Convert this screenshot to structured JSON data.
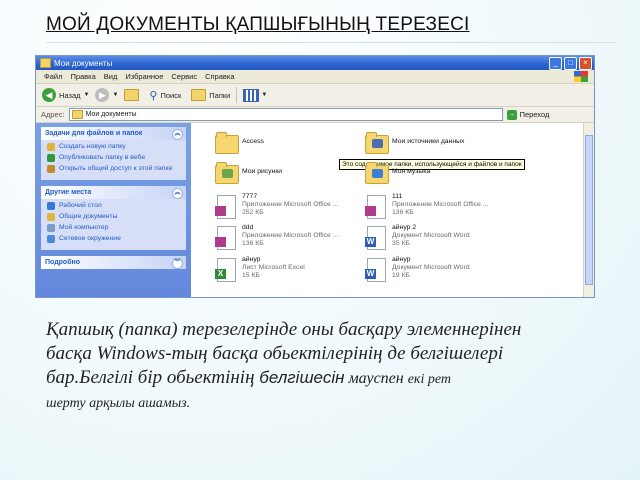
{
  "slide": {
    "title": "МОЙ ДОКУМЕНТЫ ҚАПШЫҒЫНЫҢ ТЕРЕЗЕСІ",
    "caption": {
      "line1": "Қапшық (папка) терезелерінде оны басқару элеменнерінен",
      "line2": "басқа Windows-тың басқа обьектілерінің де белгішелері",
      "line3_a": "бар.Белгілі бір  обьектінің ",
      "line3_b": "белгішесін",
      "line3_c": " мауспен ",
      "line3_d": "екі рет",
      "line4": "шерту арқылы ашамыз."
    }
  },
  "window": {
    "title": "Мои документы",
    "menu": [
      "Файл",
      "Правка",
      "Вид",
      "Избранное",
      "Сервис",
      "Справка"
    ],
    "toolbar": {
      "back": "Назад",
      "search": "Поиск",
      "folders": "Папки"
    },
    "address": {
      "label": "Адрес:",
      "value": "Мои документы",
      "go": "Переход"
    },
    "tasks": {
      "panel1_title": "Задачи для файлов и папок",
      "panel1_items": [
        {
          "label": "Создать новую папку",
          "icon": "new-folder-icon",
          "color": "#e0b53a"
        },
        {
          "label": "Опубликовать папку в вебе",
          "icon": "globe-icon",
          "color": "#2f9a3a"
        },
        {
          "label": "Открыть общий доступ к этой папке",
          "icon": "share-icon",
          "color": "#c68a2a"
        }
      ],
      "panel2_title": "Другие места",
      "panel2_items": [
        {
          "label": "Рабочий стол",
          "icon": "desktop-icon",
          "color": "#3a78d8"
        },
        {
          "label": "Общие документы",
          "icon": "folder-icon",
          "color": "#e0b53a"
        },
        {
          "label": "Мой компьютер",
          "icon": "computer-icon",
          "color": "#7a9cc8"
        },
        {
          "label": "Сетевое окружение",
          "icon": "network-icon",
          "color": "#4a8ad8"
        }
      ],
      "panel3_title": "Подробно"
    },
    "tooltip": "Это содержимое папки, использующейся и файлов и папок",
    "files": [
      {
        "name": "Ассеss",
        "sub1": "",
        "sub2": "",
        "icon": "folder-icon",
        "badge": "",
        "badge_color": ""
      },
      {
        "name": "Мои источники данных",
        "sub1": "",
        "sub2": "",
        "icon": "data-sources-folder-icon",
        "badge": "",
        "badge_color": ""
      },
      {
        "name": "Мои рисунки",
        "sub1": "",
        "sub2": "",
        "icon": "pictures-folder-icon",
        "badge": "",
        "badge_color": ""
      },
      {
        "name": "Моя музыка",
        "sub1": "",
        "sub2": "",
        "icon": "music-folder-icon",
        "badge": "",
        "badge_color": ""
      },
      {
        "name": "7777",
        "sub1": "Приложение Microsoft Office ...",
        "sub2": "252 КБ",
        "icon": "access-file-icon",
        "badge": "",
        "badge_color": "#b03a8c"
      },
      {
        "name": "111",
        "sub1": "Приложение Microsoft Office ...",
        "sub2": "136 КБ",
        "icon": "access-file-icon",
        "badge": "",
        "badge_color": "#b03a8c"
      },
      {
        "name": "ddd",
        "sub1": "Приложение Microsoft Office ...",
        "sub2": "136 КБ",
        "icon": "access-file-icon",
        "badge": "",
        "badge_color": "#b03a8c"
      },
      {
        "name": "айнур 2",
        "sub1": "Документ Microsoft Word",
        "sub2": "35 КБ",
        "icon": "word-file-icon",
        "badge": "W",
        "badge_color": "#2b5fb8"
      },
      {
        "name": "айнур",
        "sub1": "Лист Microsoft Excel",
        "sub2": "15 КБ",
        "icon": "excel-file-icon",
        "badge": "X",
        "badge_color": "#2e8b3a"
      },
      {
        "name": "айнур",
        "sub1": "Документ Microsoft Word",
        "sub2": "19 КБ",
        "icon": "word-file-icon",
        "badge": "W",
        "badge_color": "#2b5fb8"
      }
    ]
  }
}
